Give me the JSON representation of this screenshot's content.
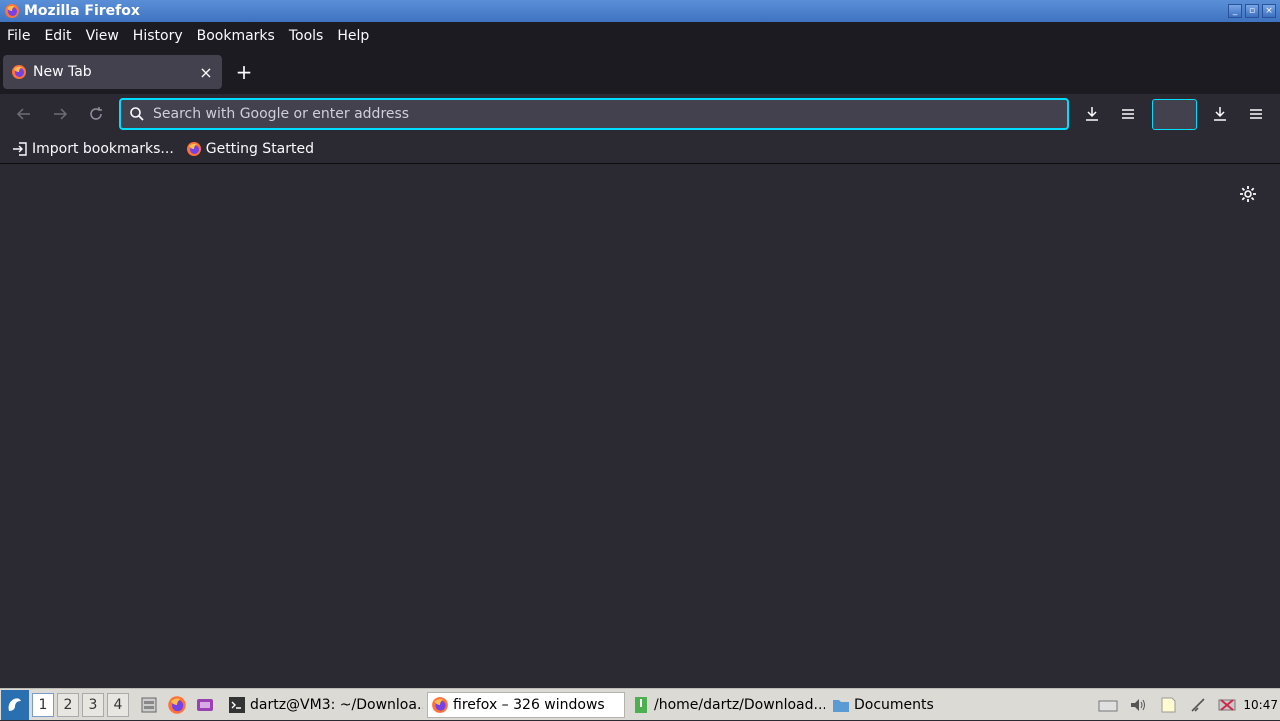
{
  "window": {
    "title": "Mozilla Firefox",
    "controls": [
      "minimize",
      "maximize",
      "close"
    ]
  },
  "menubar": {
    "items": [
      "File",
      "Edit",
      "View",
      "History",
      "Bookmarks",
      "Tools",
      "Help"
    ]
  },
  "tabs": {
    "items": [
      {
        "label": "New Tab",
        "close_glyph": "×"
      }
    ],
    "new_tab_glyph": "+"
  },
  "navbar": {
    "back_icon": "arrow-left-icon",
    "forward_icon": "arrow-right-icon",
    "reload_icon": "reload-icon",
    "search_placeholder": "Search with Google or enter address",
    "search_value": ""
  },
  "bookmarks": {
    "items": [
      {
        "label": "Import bookmarks...",
        "icon": "import-icon"
      },
      {
        "label": "Getting Started",
        "icon": "firefox-icon"
      }
    ]
  },
  "taskbar": {
    "workspaces": [
      "1",
      "2",
      "3",
      "4"
    ],
    "active_workspace": "1",
    "tasks": [
      {
        "label": "dartz@VM3: ~/Downloa...",
        "icon": "terminal-icon"
      },
      {
        "label": "firefox – 326 windows",
        "icon": "firefox-icon"
      },
      {
        "label": "/home/dartz/Download...",
        "icon": "archive-icon"
      },
      {
        "label": "Documents",
        "icon": "folder-icon"
      }
    ],
    "clock": "10:47"
  },
  "colors": {
    "accent": "#00ddff",
    "toolbar": "#2b2a33",
    "tabstrip": "#1c1b22",
    "titlebar": "#3f73c0"
  }
}
